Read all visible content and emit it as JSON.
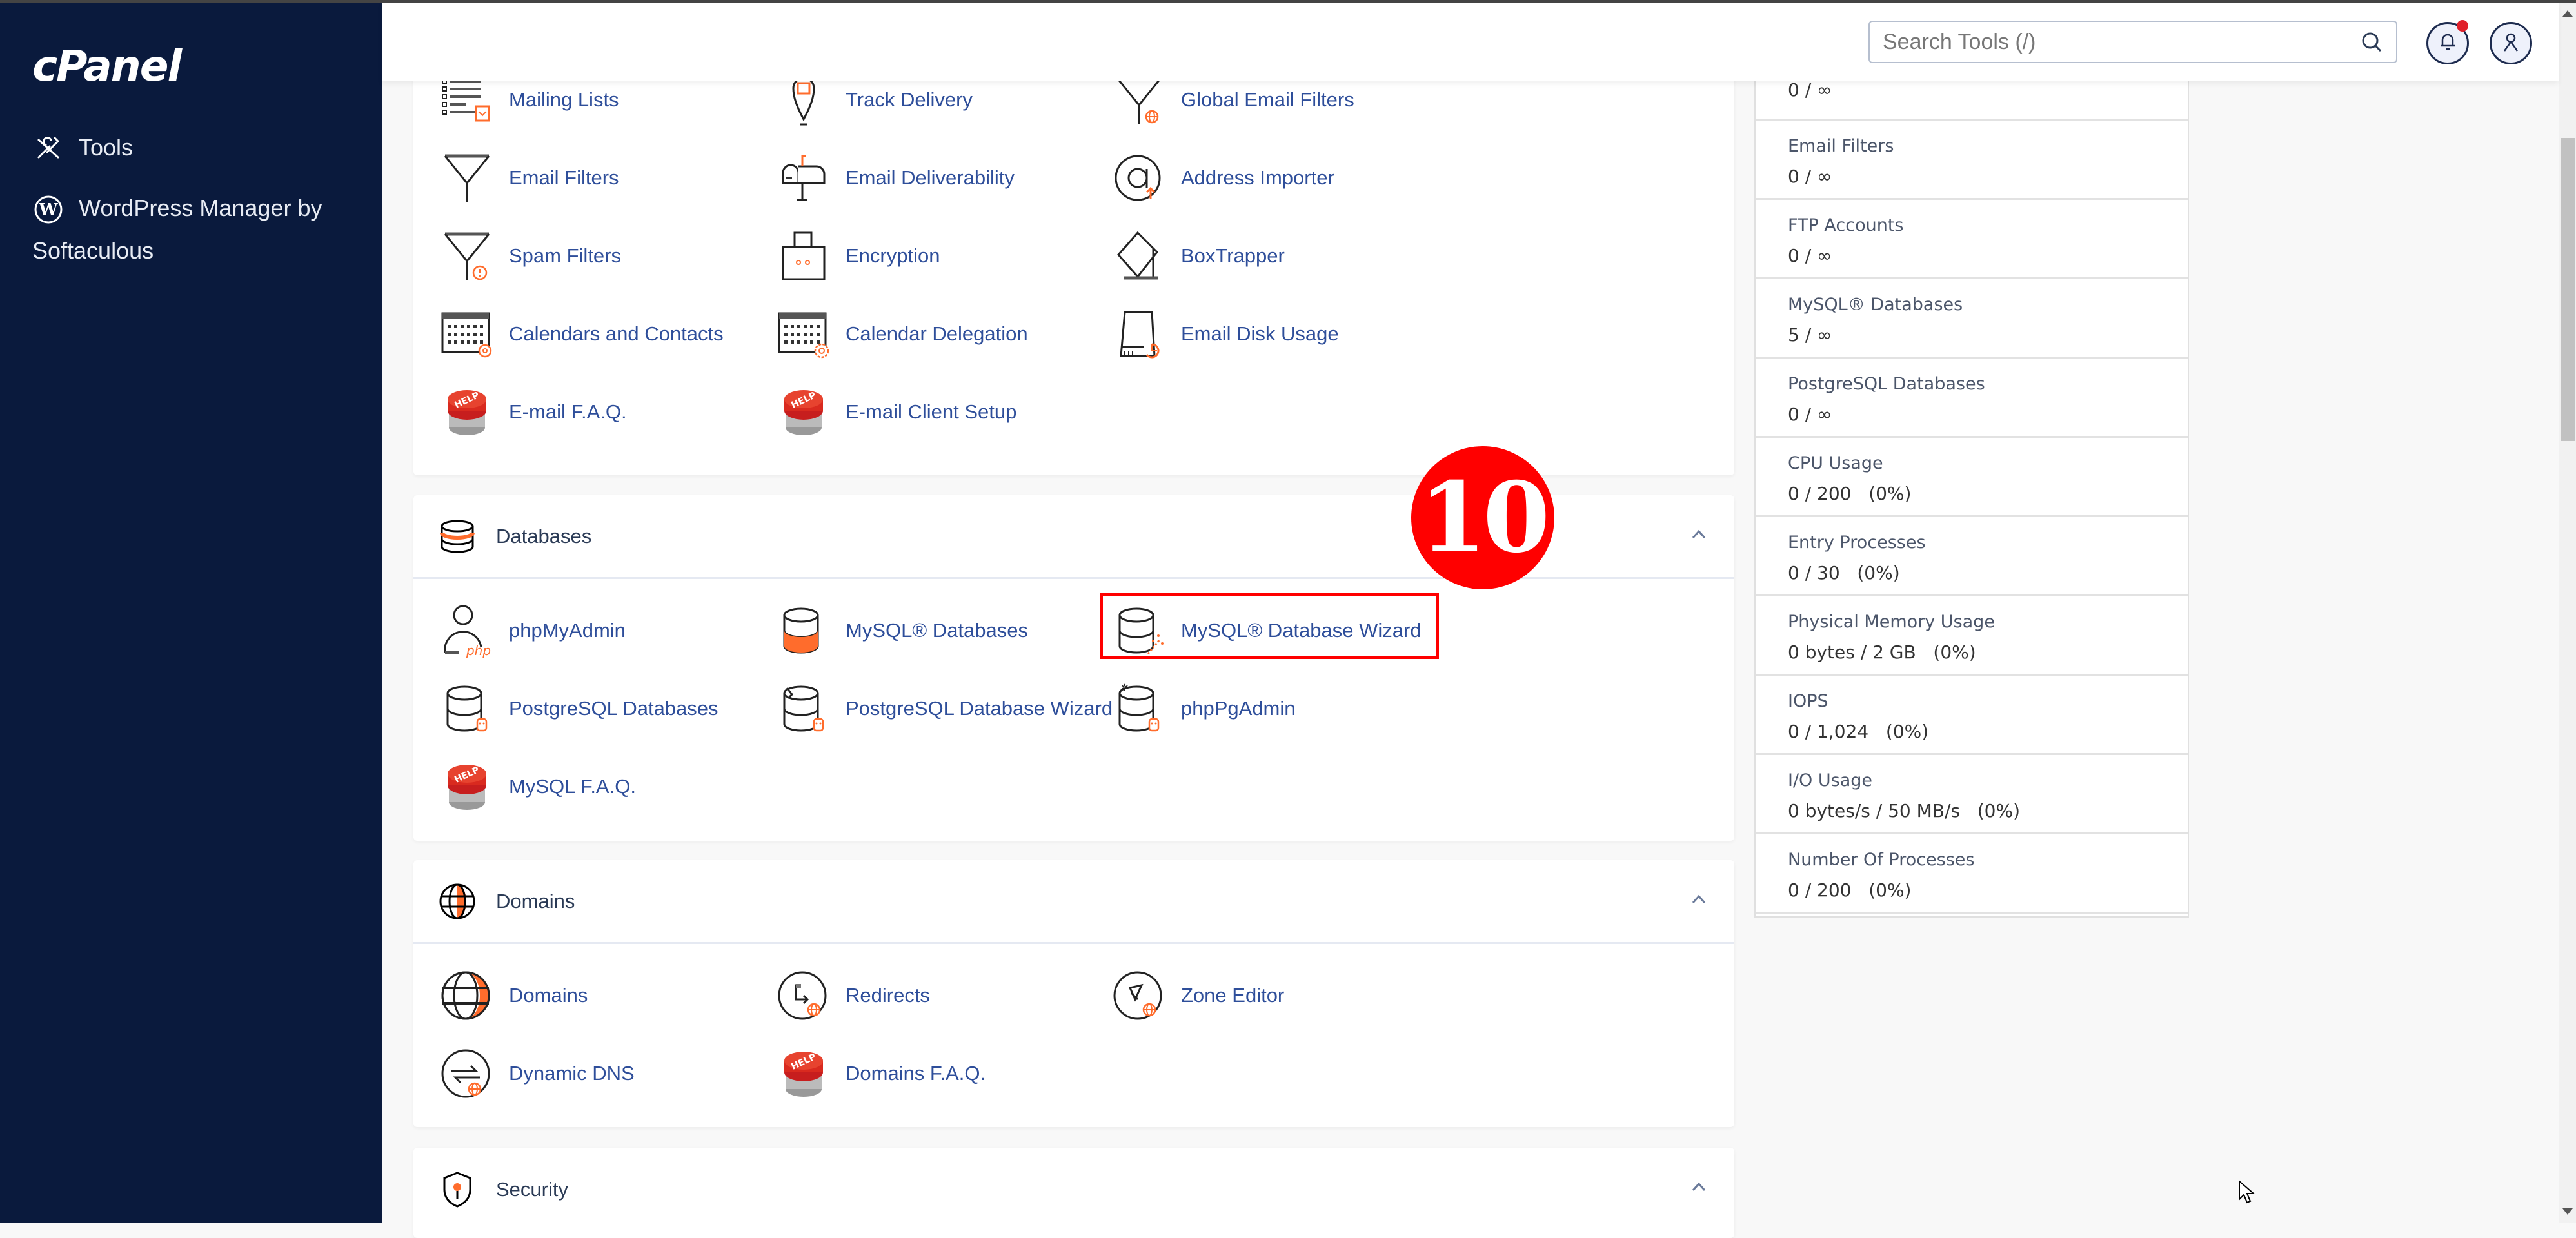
{
  "app": {
    "logo": "cPanel"
  },
  "sidebar": {
    "items": [
      {
        "label": "Tools",
        "icon": "tools-icon"
      },
      {
        "label": "WordPress Manager by Softaculous",
        "icon": "wordpress-icon"
      }
    ]
  },
  "header": {
    "search_placeholder": "Search Tools (/)",
    "notification_icon": "bell-icon",
    "user_icon": "user-icon",
    "has_notification": true
  },
  "sections": {
    "email": {
      "items": [
        {
          "label": "Mailing Lists",
          "icon": "mailing-lists-icon"
        },
        {
          "label": "Track Delivery",
          "icon": "track-delivery-icon"
        },
        {
          "label": "Global Email Filters",
          "icon": "global-email-filters-icon"
        },
        {
          "label": "Email Filters",
          "icon": "email-filters-icon"
        },
        {
          "label": "Email Deliverability",
          "icon": "mailbox-icon"
        },
        {
          "label": "Address Importer",
          "icon": "address-importer-icon"
        },
        {
          "label": "Spam Filters",
          "icon": "spam-filters-icon"
        },
        {
          "label": "Encryption",
          "icon": "encryption-icon"
        },
        {
          "label": "BoxTrapper",
          "icon": "boxtrapper-icon"
        },
        {
          "label": "Calendars and Contacts",
          "icon": "calendar-icon"
        },
        {
          "label": "Calendar Delegation",
          "icon": "calendar-delegation-icon"
        },
        {
          "label": "Email Disk Usage",
          "icon": "disk-usage-icon"
        },
        {
          "label": "E-mail F.A.Q.",
          "icon": "help-button-icon"
        },
        {
          "label": "E-mail Client Setup",
          "icon": "help-button-icon"
        }
      ]
    },
    "databases": {
      "title": "Databases",
      "items": [
        {
          "label": "phpMyAdmin",
          "icon": "phpmyadmin-icon"
        },
        {
          "label": "MySQL® Databases",
          "icon": "mysql-databases-icon"
        },
        {
          "label": "MySQL® Database Wizard",
          "icon": "mysql-wizard-icon",
          "highlighted": true
        },
        {
          "label": "PostgreSQL Databases",
          "icon": "postgresql-icon"
        },
        {
          "label": "PostgreSQL Database Wizard",
          "icon": "postgresql-wizard-icon"
        },
        {
          "label": "phpPgAdmin",
          "icon": "phppgadmin-icon"
        },
        {
          "label": "MySQL F.A.Q.",
          "icon": "help-button-icon"
        }
      ]
    },
    "domains": {
      "title": "Domains",
      "items": [
        {
          "label": "Domains",
          "icon": "globe-icon"
        },
        {
          "label": "Redirects",
          "icon": "redirects-icon"
        },
        {
          "label": "Zone Editor",
          "icon": "zone-editor-icon"
        },
        {
          "label": "Dynamic DNS",
          "icon": "dynamic-dns-icon"
        },
        {
          "label": "Domains F.A.Q.",
          "icon": "help-button-icon"
        }
      ]
    },
    "security": {
      "title": "Security"
    }
  },
  "stats": [
    {
      "label": "",
      "value": "0 / ∞"
    },
    {
      "label": "Email Filters",
      "value": "0 / ∞"
    },
    {
      "label": "FTP Accounts",
      "value": "0 / ∞"
    },
    {
      "label": "MySQL® Databases",
      "value": "5 / ∞"
    },
    {
      "label": "PostgreSQL Databases",
      "value": "0 / ∞"
    },
    {
      "label": "CPU Usage",
      "value": "0 / 200   (0%)"
    },
    {
      "label": "Entry Processes",
      "value": "0 / 30   (0%)"
    },
    {
      "label": "Physical Memory Usage",
      "value": "0 bytes / 2 GB   (0%)"
    },
    {
      "label": "IOPS",
      "value": "0 / 1,024   (0%)"
    },
    {
      "label": "I/O Usage",
      "value": "0 bytes/s / 50 MB/s   (0%)"
    },
    {
      "label": "Number Of Processes",
      "value": "0 / 200   (0%)"
    }
  ],
  "annotation": {
    "step": "10"
  },
  "colors": {
    "sidebar_bg": "#0a1a3d",
    "accent_orange": "#ff6c2c",
    "link_blue": "#2e4e9a",
    "highlight_red": "#ff0000"
  }
}
